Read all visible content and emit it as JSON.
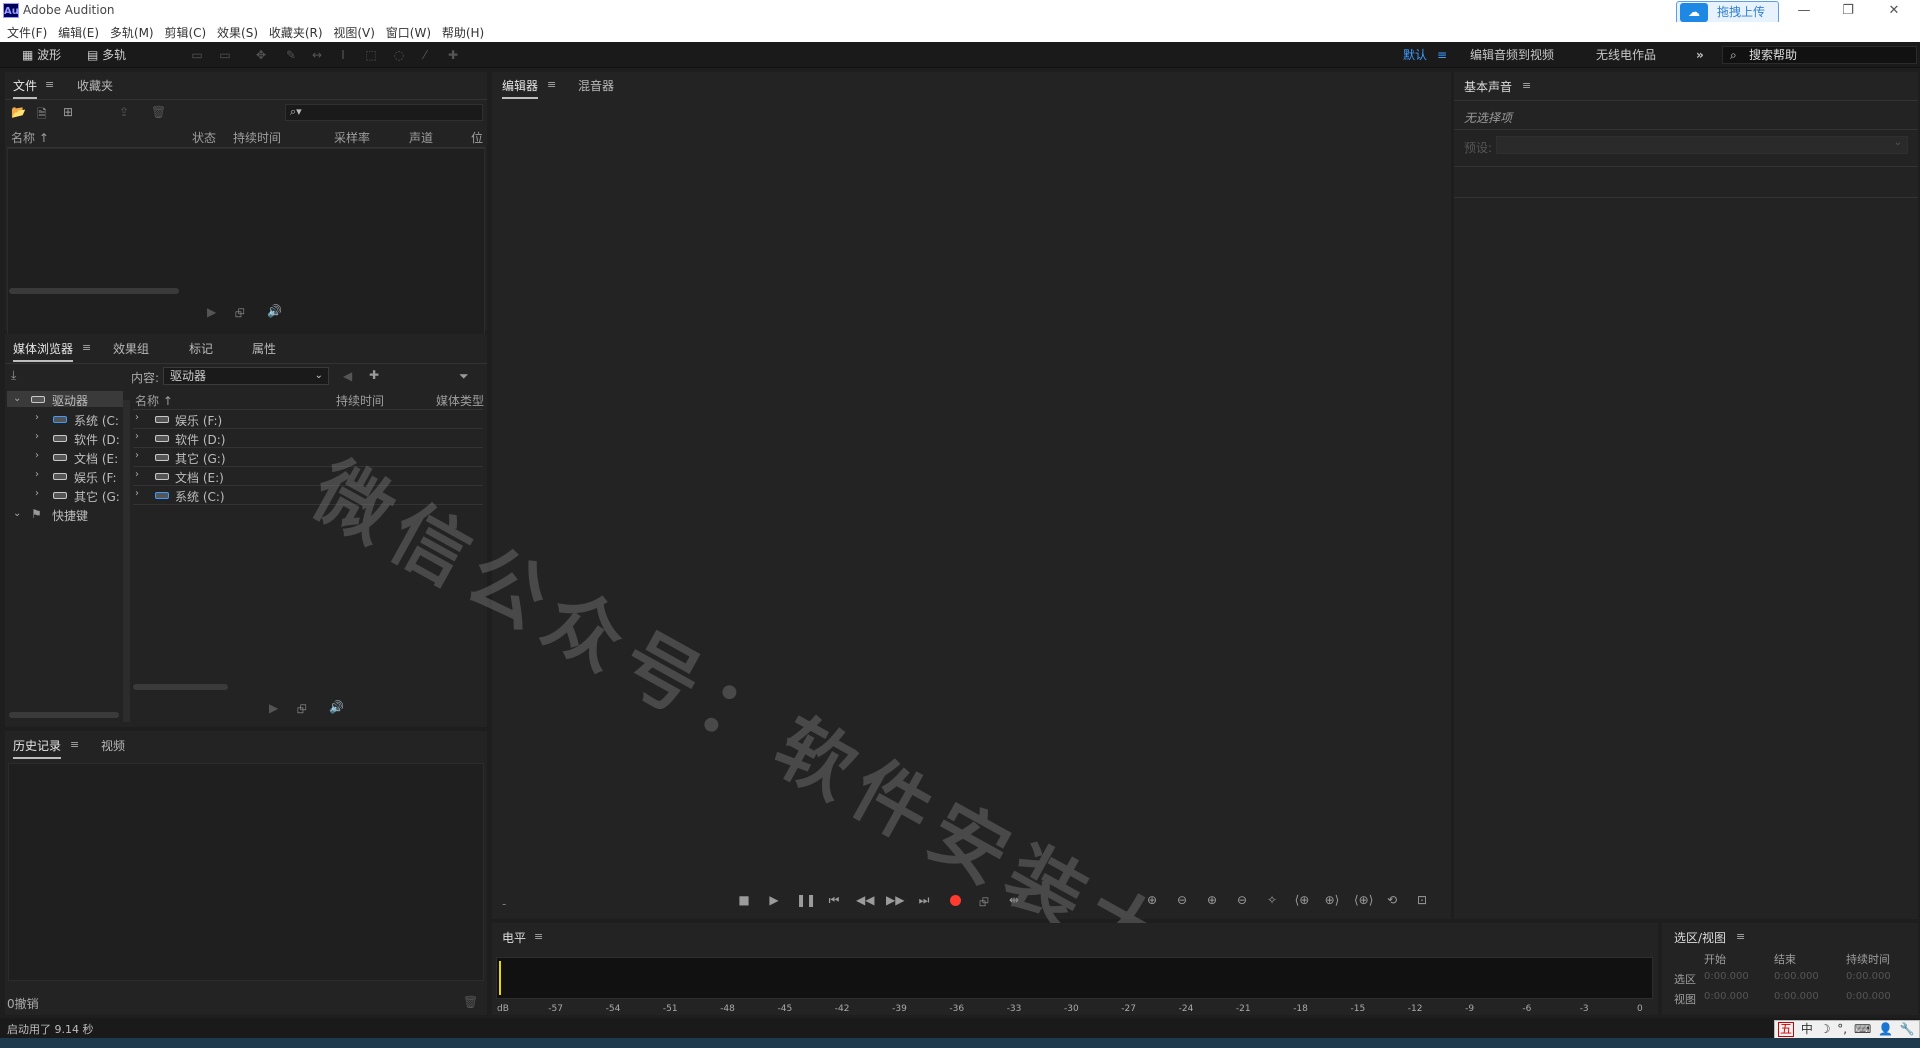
{
  "window": {
    "logo": "Au",
    "title": "Adobe Audition",
    "upload_button": "拖拽上传"
  },
  "menu": [
    "文件(F)",
    "编辑(E)",
    "多轨(M)",
    "剪辑(C)",
    "效果(S)",
    "收藏夹(R)",
    "视图(V)",
    "窗口(W)",
    "帮助(H)"
  ],
  "toolbar": {
    "waveform_label": "波形",
    "multitrack_label": "多轨",
    "workspaces": [
      "默认",
      "编辑音频到视频",
      "无线电作品"
    ],
    "more": "»",
    "search_help_placeholder": "搜索帮助"
  },
  "files_panel": {
    "tabs": [
      "文件",
      "收藏夹"
    ],
    "columns": [
      "名称",
      "状态",
      "持续时间",
      "采样率",
      "声道",
      "位"
    ]
  },
  "media_browser": {
    "tabs": [
      "媒体浏览器",
      "效果组",
      "标记",
      "属性"
    ],
    "content_label": "内容:",
    "content_value": "驱动器",
    "tree": {
      "root": "驱动器",
      "drives": [
        "系统 (C:",
        "软件 (D:",
        "文档 (E:",
        "娱乐 (F:",
        "其它 (G:"
      ],
      "shortcuts": "快捷键"
    },
    "columns": [
      "名称",
      "持续时间",
      "媒体类型"
    ],
    "list": [
      "娱乐 (F:)",
      "软件 (D:)",
      "其它 (G:)",
      "文档 (E:)",
      "系统 (C:)"
    ]
  },
  "history_panel": {
    "tabs": [
      "历史记录",
      "视频"
    ],
    "undo_count": "0撤销"
  },
  "editor_panel": {
    "tabs": [
      "编辑器",
      "混音器"
    ],
    "time_display": "-"
  },
  "essential_sound": {
    "title": "基本声音",
    "no_selection": "无选择项",
    "preset_label": "预设:"
  },
  "levels_panel": {
    "title": "电平",
    "scale": [
      "dB",
      "-57",
      "-54",
      "-51",
      "-48",
      "-45",
      "-42",
      "-39",
      "-36",
      "-33",
      "-30",
      "-27",
      "-24",
      "-21",
      "-18",
      "-15",
      "-12",
      "-9",
      "-6",
      "-3",
      "0"
    ]
  },
  "selection_view": {
    "title": "选区/视图",
    "headers": [
      "开始",
      "结束",
      "持续时间"
    ],
    "rows": [
      {
        "label": "选区",
        "values": [
          "0:00.000",
          "0:00.000",
          "0:00.000"
        ]
      },
      {
        "label": "视图",
        "values": [
          "0:00.000",
          "0:00.000",
          "0:00.000"
        ]
      }
    ]
  },
  "status": {
    "text": "启动用了 9.14 秒"
  },
  "ime_bar": [
    "五",
    "中",
    "☽",
    "°,",
    "⌨",
    "👤",
    "🔧"
  ],
  "watermark": "微信公众号：软件安装大神",
  "colors": {
    "accent": "#3d9bff",
    "record": "#ff3b30",
    "panel": "#232323",
    "background": "#1e1e1e"
  }
}
